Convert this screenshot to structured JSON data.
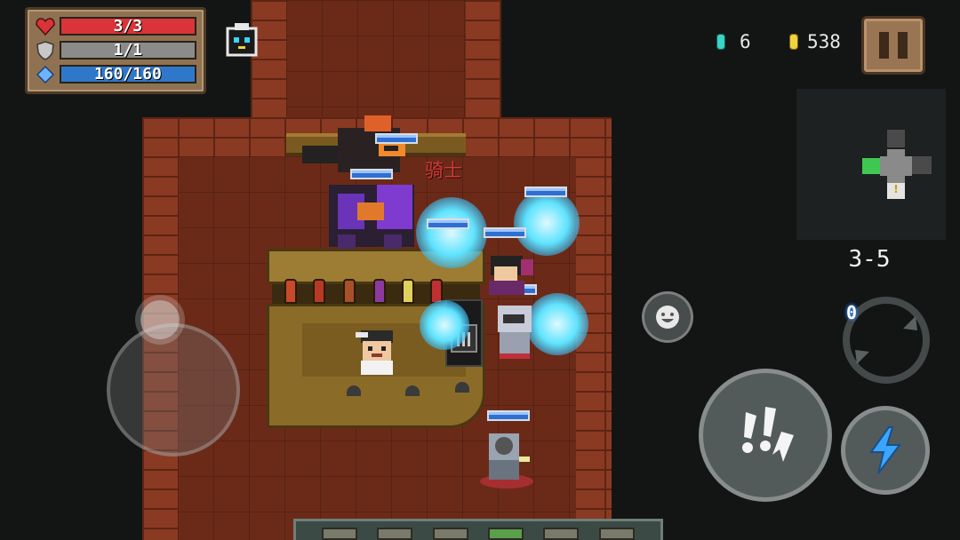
{
  "stats": {
    "health": {
      "current": 3,
      "max": 3,
      "text": "3/3"
    },
    "armor": {
      "current": 1,
      "max": 1,
      "text": "1/1"
    },
    "energy": {
      "current": 160,
      "max": 160,
      "text": "160/160"
    }
  },
  "currency": {
    "gems": "6",
    "coins": "538"
  },
  "level": "3-5",
  "enemy_name": "骑士",
  "weapon_energy_cost": "0",
  "icons": {
    "health": "heart-icon",
    "armor": "shield-icon",
    "energy": "diamond-icon",
    "gem": "gem-icon",
    "coin": "coin-icon",
    "pause": "pause-icon",
    "emote": "smiley-icon",
    "attack": "attack-burst-icon",
    "skill": "lightning-icon",
    "swap": "swap-weapon-icon"
  },
  "colors": {
    "health": "#d8343a",
    "armor": "#8b8b8b",
    "energy": "#2f78c9",
    "enemy_name": "#d23a3a",
    "minimap_player": "#3ec852"
  }
}
